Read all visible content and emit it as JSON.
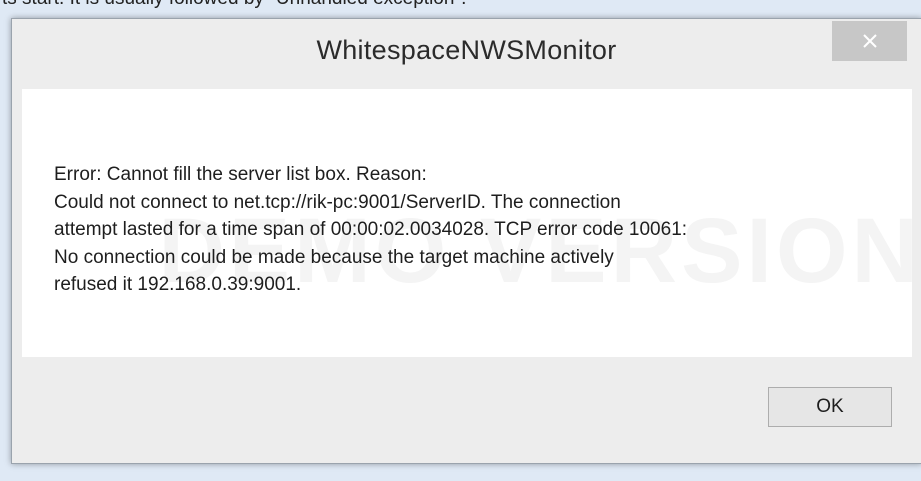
{
  "background": {
    "text": "ts start. It is usually followed by \"Unhandled exception\"."
  },
  "dialog": {
    "title": "WhitespaceNWSMonitor",
    "close_icon": "close-icon",
    "watermark": "DEMO VERSION",
    "message_lines": [
      "Error: Cannot fill the server list box.  Reason:",
      "Could not connect to net.tcp://rik-pc:9001/ServerID. The connection",
      "attempt lasted for a time span of 00:00:02.0034028. TCP error code 10061:",
      "No connection could be made because the target machine actively",
      "refused it 192.168.0.39:9001."
    ],
    "ok_label": "OK"
  },
  "colors": {
    "page_background": "#dfe9f5",
    "dialog_chrome": "#ededed",
    "content_background": "#ffffff",
    "close_button": "#c7c7c7"
  }
}
